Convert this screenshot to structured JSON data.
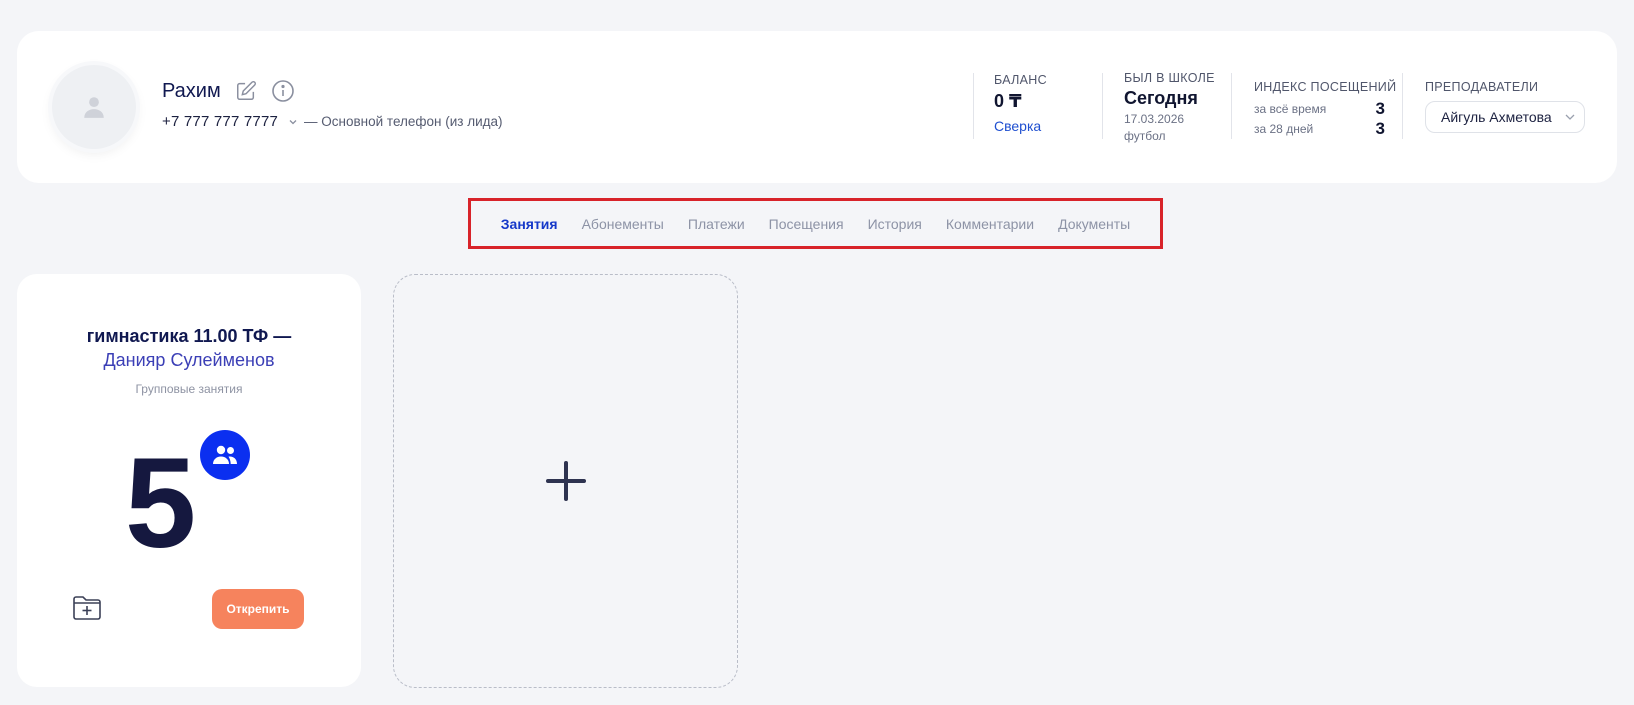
{
  "client": {
    "name": "Рахим",
    "phone": "+7 777 777 7777",
    "phone_note": "— Основной телефон (из лида)"
  },
  "stats": {
    "balance": {
      "label": "БАЛАНС",
      "value": "0 ₸",
      "link": "Сверка"
    },
    "last_visit": {
      "label": "БЫЛ В ШКОЛЕ",
      "value": "Сегодня",
      "date": "17.03.2026",
      "activity": "футбол"
    },
    "attendance": {
      "label": "ИНДЕКС ПОСЕЩЕНИЙ",
      "all_time_label": "за всё время",
      "all_time_value": "3",
      "days28_label": "за 28 дней",
      "days28_value": "3"
    },
    "teachers": {
      "label": "ПРЕПОДАВАТЕЛИ",
      "selected": "Айгуль Ахметова"
    }
  },
  "tabs": [
    "Занятия",
    "Абонементы",
    "Платежи",
    "Посещения",
    "История",
    "Комментарии",
    "Документы"
  ],
  "active_tab": "Занятия",
  "course": {
    "title": "гимнастика 11.00 ТФ —",
    "teacher": "Данияр Сулейменов",
    "type": "Групповые занятия",
    "count": "5",
    "detach_label": "Открепить"
  },
  "colors": {
    "accent": "#1538c9",
    "badge": "#0b2ff0",
    "detach": "#f6835d",
    "highlight": "#d8232a"
  },
  "icons": [
    "user-avatar-icon",
    "edit-icon",
    "info-icon",
    "chevron-down-icon",
    "group-icon",
    "folder-add-icon",
    "plus-icon"
  ]
}
